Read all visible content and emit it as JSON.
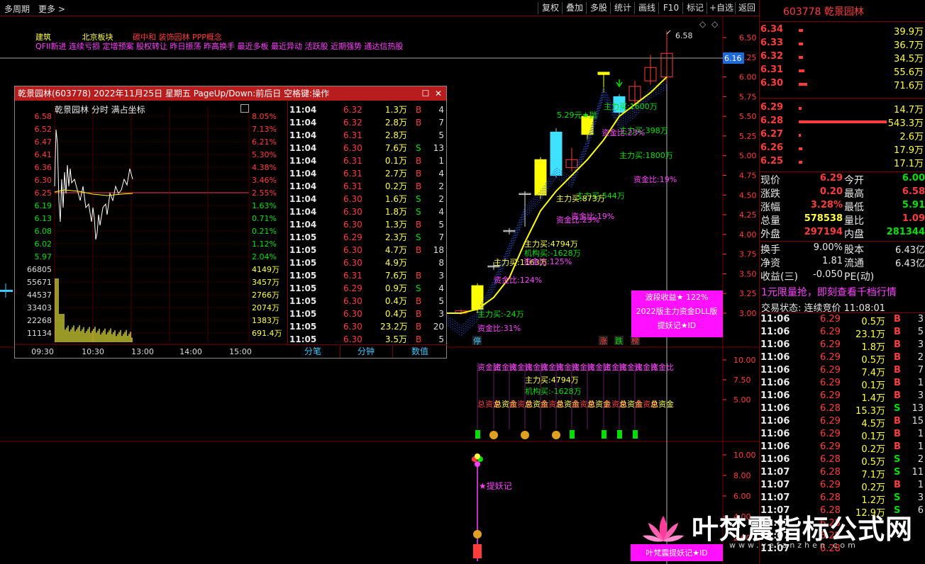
{
  "toolbar": {
    "left": [
      "多周期",
      "更多 >"
    ],
    "buttons": [
      "复权",
      "叠加",
      "多股",
      "统计",
      "画线",
      "F10",
      "标记",
      "+自选",
      "返回"
    ]
  },
  "header": {
    "concepts_line1": [
      {
        "text": "建筑",
        "color": "#ffff40"
      },
      {
        "text": "北京板块",
        "color": "#ffff40"
      },
      {
        "text": "碳中和 装饰园林 PPP概念",
        "color": "#ff3c3c"
      }
    ],
    "concepts_line2": "QFII新进 连续亏损 定增预案 股权转让 昨日振荡 昨高换手 最近多板 最近异动 活跃股 近期强势 通达信热股"
  },
  "main_chart": {
    "price_axis": [
      "6.50",
      "6.25",
      "6.00",
      "5.75",
      "5.50",
      "5.25",
      "5.00",
      "4.75",
      "4.50",
      "4.25",
      "4.00",
      "3.75",
      "3.50",
      "3.25",
      "3.00"
    ],
    "current_price_tag": "6.16",
    "high_label": "6.58",
    "annotations": [
      {
        "text": "5.29元★抛",
        "color": "#00e000"
      },
      {
        "text": "主力买:1600万",
        "color": "#00e000"
      },
      {
        "text": "主力买:398万",
        "color": "#00e000"
      },
      {
        "text": "资金比:23%",
        "color": "#ff40ff"
      },
      {
        "text": "主力买:1800万",
        "color": "#00e000"
      },
      {
        "text": "资金比:19%",
        "color": "#ff40ff"
      },
      {
        "text": "主力买:544万",
        "color": "#00e000"
      },
      {
        "text": "主力买:873万",
        "color": "#ffff40"
      },
      {
        "text": "资金比:19%",
        "color": "#ff40ff"
      },
      {
        "text": "资金比:23%",
        "color": "#ff40ff"
      },
      {
        "text": "主力买:4794万",
        "color": "#ffff40"
      },
      {
        "text": "机构买:-1628万",
        "color": "#00e000"
      },
      {
        "text": "主力买:1163万",
        "color": "#ffff40"
      },
      {
        "text": "资金比:125%",
        "color": "#ff40ff"
      },
      {
        "text": "资金比:124%",
        "color": "#ff40ff"
      },
      {
        "text": "主力买:-24万",
        "color": "#00e000"
      },
      {
        "text": "资金比:31%",
        "color": "#ff40ff"
      }
    ],
    "bottom_marks": [
      "停",
      "涨",
      "跌",
      "榜"
    ],
    "promo_box": [
      "波段收益★ 122%",
      "2022版主力资金DLL版",
      "提妖记★ID"
    ]
  },
  "sub_chart1": {
    "axis": [
      "10.00",
      "7.50",
      "5.00"
    ],
    "labels": [
      "资金比",
      "主力买:4794万",
      "机构买:-1628万",
      "总资金"
    ]
  },
  "sub_chart2": {
    "axis": [
      "10.00",
      "8.00",
      "6.00",
      "4.00",
      "2.00"
    ],
    "label": "★提妖记",
    "bottom_box": "叶梵震提妖记★ID",
    "watermark": "叶梵震指标公式网",
    "watermark_url": "www.yefanzhen.com"
  },
  "popup": {
    "title": "乾景园林(603778) 2022年11月25日 星期五 PageUp/Down:前后日 空格键:操作",
    "chart_title": "乾景园林  分时  满占坐标",
    "price_levels": [
      "6.58",
      "6.52",
      "6.47",
      "6.41",
      "6.36",
      "6.30",
      "6.25",
      "6.19",
      "6.13",
      "6.08",
      "6.02",
      "5.97"
    ],
    "pct_levels": [
      "8.05%",
      "7.13%",
      "6.21%",
      "5.30%",
      "4.38%",
      "3.46%",
      "2.55%",
      "1.63%",
      "0.71%",
      "0.21%",
      "1.12%",
      "2.04%"
    ],
    "vol_levels": [
      "66805",
      "55671",
      "44537",
      "33403",
      "22268",
      "11134"
    ],
    "amt_levels": [
      "4149万",
      "3457万",
      "2766万",
      "2074万",
      "1383万",
      "691.4万"
    ],
    "time_axis": [
      "09:30",
      "10:30",
      "13:00",
      "14:00",
      "15:00"
    ],
    "ticks": [
      [
        "11:04",
        "6.32",
        "1.3万",
        "B",
        "4"
      ],
      [
        "11:04",
        "6.32",
        "2.8万",
        "B",
        "7"
      ],
      [
        "11:04",
        "6.31",
        "2.8万",
        "",
        "5"
      ],
      [
        "11:04",
        "6.30",
        "7.6万",
        "S",
        "13"
      ],
      [
        "11:04",
        "6.31",
        "0.1万",
        "B",
        "1"
      ],
      [
        "11:04",
        "6.31",
        "2.7万",
        "B",
        "4"
      ],
      [
        "11:04",
        "6.31",
        "0.2万",
        "B",
        "2"
      ],
      [
        "11:04",
        "6.30",
        "1.6万",
        "S",
        "2"
      ],
      [
        "11:04",
        "6.30",
        "1.8万",
        "S",
        "4"
      ],
      [
        "11:04",
        "6.30",
        "1.3万",
        "B",
        "5"
      ],
      [
        "11:05",
        "6.29",
        "2.3万",
        "S",
        "7"
      ],
      [
        "11:05",
        "6.30",
        "4.7万",
        "B",
        "18"
      ],
      [
        "11:05",
        "6.30",
        "4.9万",
        "",
        "8"
      ],
      [
        "11:05",
        "6.31",
        "7.6万",
        "B",
        "3"
      ],
      [
        "11:05",
        "6.29",
        "0.9万",
        "S",
        "4"
      ],
      [
        "11:05",
        "6.30",
        "0.4万",
        "B",
        "5"
      ],
      [
        "11:05",
        "6.30",
        "0.4万",
        "B",
        "3"
      ],
      [
        "11:05",
        "6.30",
        "23.2万",
        "B",
        "20"
      ],
      [
        "11:05",
        "6.30",
        "3.5万",
        "B",
        "5"
      ]
    ],
    "tabs": [
      "分笔",
      "分钟",
      "数值"
    ]
  },
  "right_panel": {
    "title": "603778 乾景园林",
    "asks": [
      {
        "price": "6.34",
        "vol": "39.9万",
        "bar": 0.1
      },
      {
        "price": "6.33",
        "vol": "36.7万",
        "bar": 0.1
      },
      {
        "price": "6.32",
        "vol": "34.5万",
        "bar": 0.1
      },
      {
        "price": "6.31",
        "vol": "55.6万",
        "bar": 0.14
      },
      {
        "price": "6.30",
        "vol": "71.6万",
        "bar": 0.2
      }
    ],
    "bids": [
      {
        "price": "6.29",
        "vol": "14.7万",
        "bar": 0.03
      },
      {
        "price": "6.28",
        "vol": "543.3万",
        "bar": 1.0
      },
      {
        "price": "6.27",
        "vol": "2.6万",
        "bar": 0.02
      },
      {
        "price": "6.26",
        "vol": "17.9万",
        "bar": 0.04
      },
      {
        "price": "6.25",
        "vol": "17.1万",
        "bar": 0.04
      }
    ],
    "stats": [
      [
        {
          "label": "现价",
          "value": "6.29",
          "color": "#ff3c3c"
        },
        {
          "label": "今开",
          "value": "6.00",
          "color": "#00e000"
        }
      ],
      [
        {
          "label": "涨跌",
          "value": "0.20",
          "color": "#ff3c3c"
        },
        {
          "label": "最高",
          "value": "6.58",
          "color": "#ff3c3c"
        }
      ],
      [
        {
          "label": "涨幅",
          "value": "3.28%",
          "color": "#ff3c3c"
        },
        {
          "label": "最低",
          "value": "5.91",
          "color": "#00e000"
        }
      ],
      [
        {
          "label": "总量",
          "value": "578538",
          "color": "#ffff40"
        },
        {
          "label": "量比",
          "value": "1.09",
          "color": "#ff3c3c"
        }
      ],
      [
        {
          "label": "外盘",
          "value": "297194",
          "color": "#ff3c3c"
        },
        {
          "label": "内盘",
          "value": "281344",
          "color": "#00e000"
        }
      ]
    ],
    "stats2": [
      [
        {
          "label": "换手",
          "value": "9.00%",
          "color": "#e8e8e8"
        },
        {
          "label": "股本",
          "value": "6.43亿",
          "color": "#e8e8e8"
        }
      ],
      [
        {
          "label": "净资",
          "value": "1.81",
          "color": "#e8e8e8"
        },
        {
          "label": "流通",
          "value": "6.43亿",
          "color": "#e8e8e8"
        }
      ],
      [
        {
          "label": "收益(三)",
          "value": "-0.050",
          "color": "#e8e8e8"
        },
        {
          "label": "PE(动)",
          "value": "",
          "color": "#e8e8e8"
        }
      ]
    ],
    "promo": "1元限量抢，即刻查看千档行情",
    "status": "交易状态: 连续竞价 11:08:01",
    "ticks": [
      [
        "11:06",
        "6.29",
        "0.5万",
        "B",
        "3"
      ],
      [
        "11:06",
        "6.29",
        "23.1万",
        "B",
        "5"
      ],
      [
        "11:06",
        "6.29",
        "1.8万",
        "B",
        "3"
      ],
      [
        "11:06",
        "6.29",
        "0.5万",
        "B",
        "2"
      ],
      [
        "11:06",
        "6.29",
        "7.4万",
        "B",
        "7"
      ],
      [
        "11:06",
        "6.29",
        "0.1万",
        "B",
        "1"
      ],
      [
        "11:06",
        "6.29",
        "1.4万",
        "B",
        "3"
      ],
      [
        "11:06",
        "6.28",
        "15.3万",
        "S",
        "13"
      ],
      [
        "11:06",
        "6.29",
        "4.5万",
        "B",
        "15"
      ],
      [
        "11:06",
        "6.29",
        "0.1万",
        "B",
        "1"
      ],
      [
        "11:06",
        "6.29",
        "0.2万",
        "B",
        "1"
      ],
      [
        "11:06",
        "6.28",
        "0.5万",
        "S",
        "2"
      ],
      [
        "11:07",
        "6.28",
        "7.1万",
        "S",
        "11"
      ],
      [
        "11:07",
        "6.29",
        "0.2万",
        "B",
        "1"
      ],
      [
        "11:07",
        "6.28",
        "1.2万",
        "S",
        "3"
      ],
      [
        "11:07",
        "6.28",
        "12.9万",
        "S",
        "6"
      ],
      [
        "11:07",
        "6.28",
        "",
        "",
        ""
      ],
      [
        "11:07",
        "6.28",
        "",
        "",
        ""
      ],
      [
        "11:07",
        "6.28",
        "",
        "",
        ""
      ]
    ]
  }
}
